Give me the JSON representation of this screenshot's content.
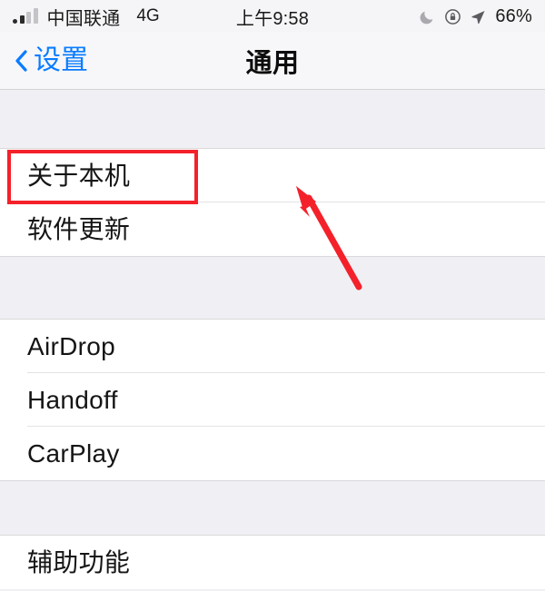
{
  "status_bar": {
    "carrier": "中国联通",
    "network_type": "4G",
    "time": "上午9:58",
    "battery_percent": "66%",
    "icons": [
      "signal-bars-icon",
      "do-not-disturb-moon-icon",
      "rotation-lock-icon",
      "location-arrow-icon"
    ]
  },
  "nav_bar": {
    "back_label": "设置",
    "back_icon": "chevron-left-icon",
    "title": "通用"
  },
  "groups": [
    {
      "name": "about-group",
      "rows": [
        {
          "label": "关于本机",
          "name": "about-this-phone"
        },
        {
          "label": "软件更新",
          "name": "software-update"
        }
      ]
    },
    {
      "name": "sharing-group",
      "rows": [
        {
          "label": "AirDrop",
          "name": "airdrop"
        },
        {
          "label": "Handoff",
          "name": "handoff"
        },
        {
          "label": "CarPlay",
          "name": "carplay"
        }
      ]
    },
    {
      "name": "accessibility-group",
      "rows": [
        {
          "label": "辅助功能",
          "name": "accessibility"
        }
      ]
    }
  ],
  "annotation": {
    "highlight_target": "关于本机",
    "highlight_color": "#f4212a",
    "arrow_color": "#f4212a",
    "arrow_points_to": "关于本机"
  }
}
